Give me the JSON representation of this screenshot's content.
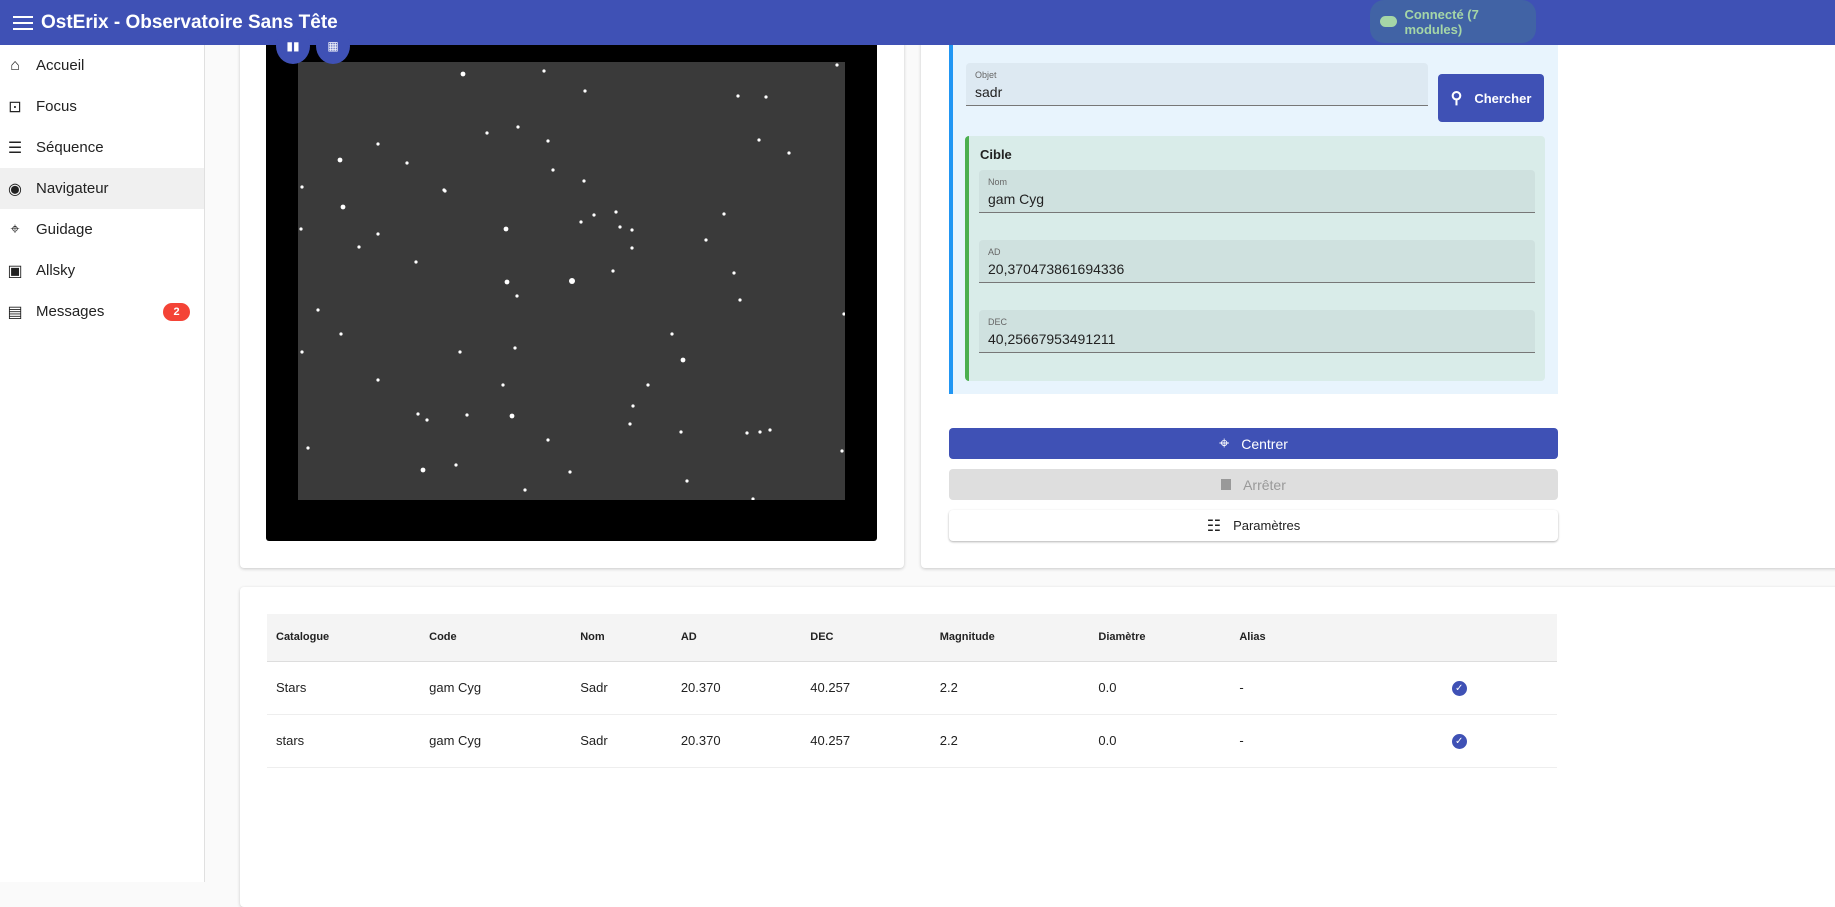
{
  "app": {
    "title": "OstErix - Observatoire Sans Tête",
    "status": "Connecté  (7 modules)"
  },
  "sidebar": {
    "items": [
      {
        "label": "Accueil",
        "icon": "home-icon"
      },
      {
        "label": "Focus",
        "icon": "focus-icon"
      },
      {
        "label": "Séquence",
        "icon": "list-icon"
      },
      {
        "label": "Navigateur",
        "icon": "compass-icon"
      },
      {
        "label": "Guidage",
        "icon": "crosshair-icon"
      },
      {
        "label": "Allsky",
        "icon": "image-icon"
      },
      {
        "label": "Messages",
        "icon": "message-icon",
        "badge": "2"
      }
    ]
  },
  "search": {
    "label": "Objet",
    "value": "sadr",
    "button": "Chercher"
  },
  "target": {
    "title": "Cible",
    "name_label": "Nom",
    "name": "gam Cyg",
    "ra_label": "AD",
    "ra": "20,370473861694336",
    "dec_label": "DEC",
    "dec": "40,25667953491211"
  },
  "actions": {
    "center": "Centrer",
    "stop": "Arrêter",
    "settings": "Paramètres"
  },
  "table": {
    "headers": [
      "Catalogue",
      "Code",
      "Nom",
      "AD",
      "DEC",
      "Magnitude",
      "Diamètre",
      "Alias",
      ""
    ],
    "rows": [
      [
        "Stars",
        "gam Cyg",
        "Sadr",
        "20.370",
        "40.257",
        "2.2",
        "0.0",
        "-"
      ],
      [
        "stars",
        "gam Cyg",
        "Sadr",
        "20.370",
        "40.257",
        "2.2",
        "0.0",
        "-"
      ]
    ]
  },
  "colors": {
    "primary": "#3f51b5",
    "success": "#4caf50",
    "info": "#2196f3",
    "danger": "#f44336"
  }
}
